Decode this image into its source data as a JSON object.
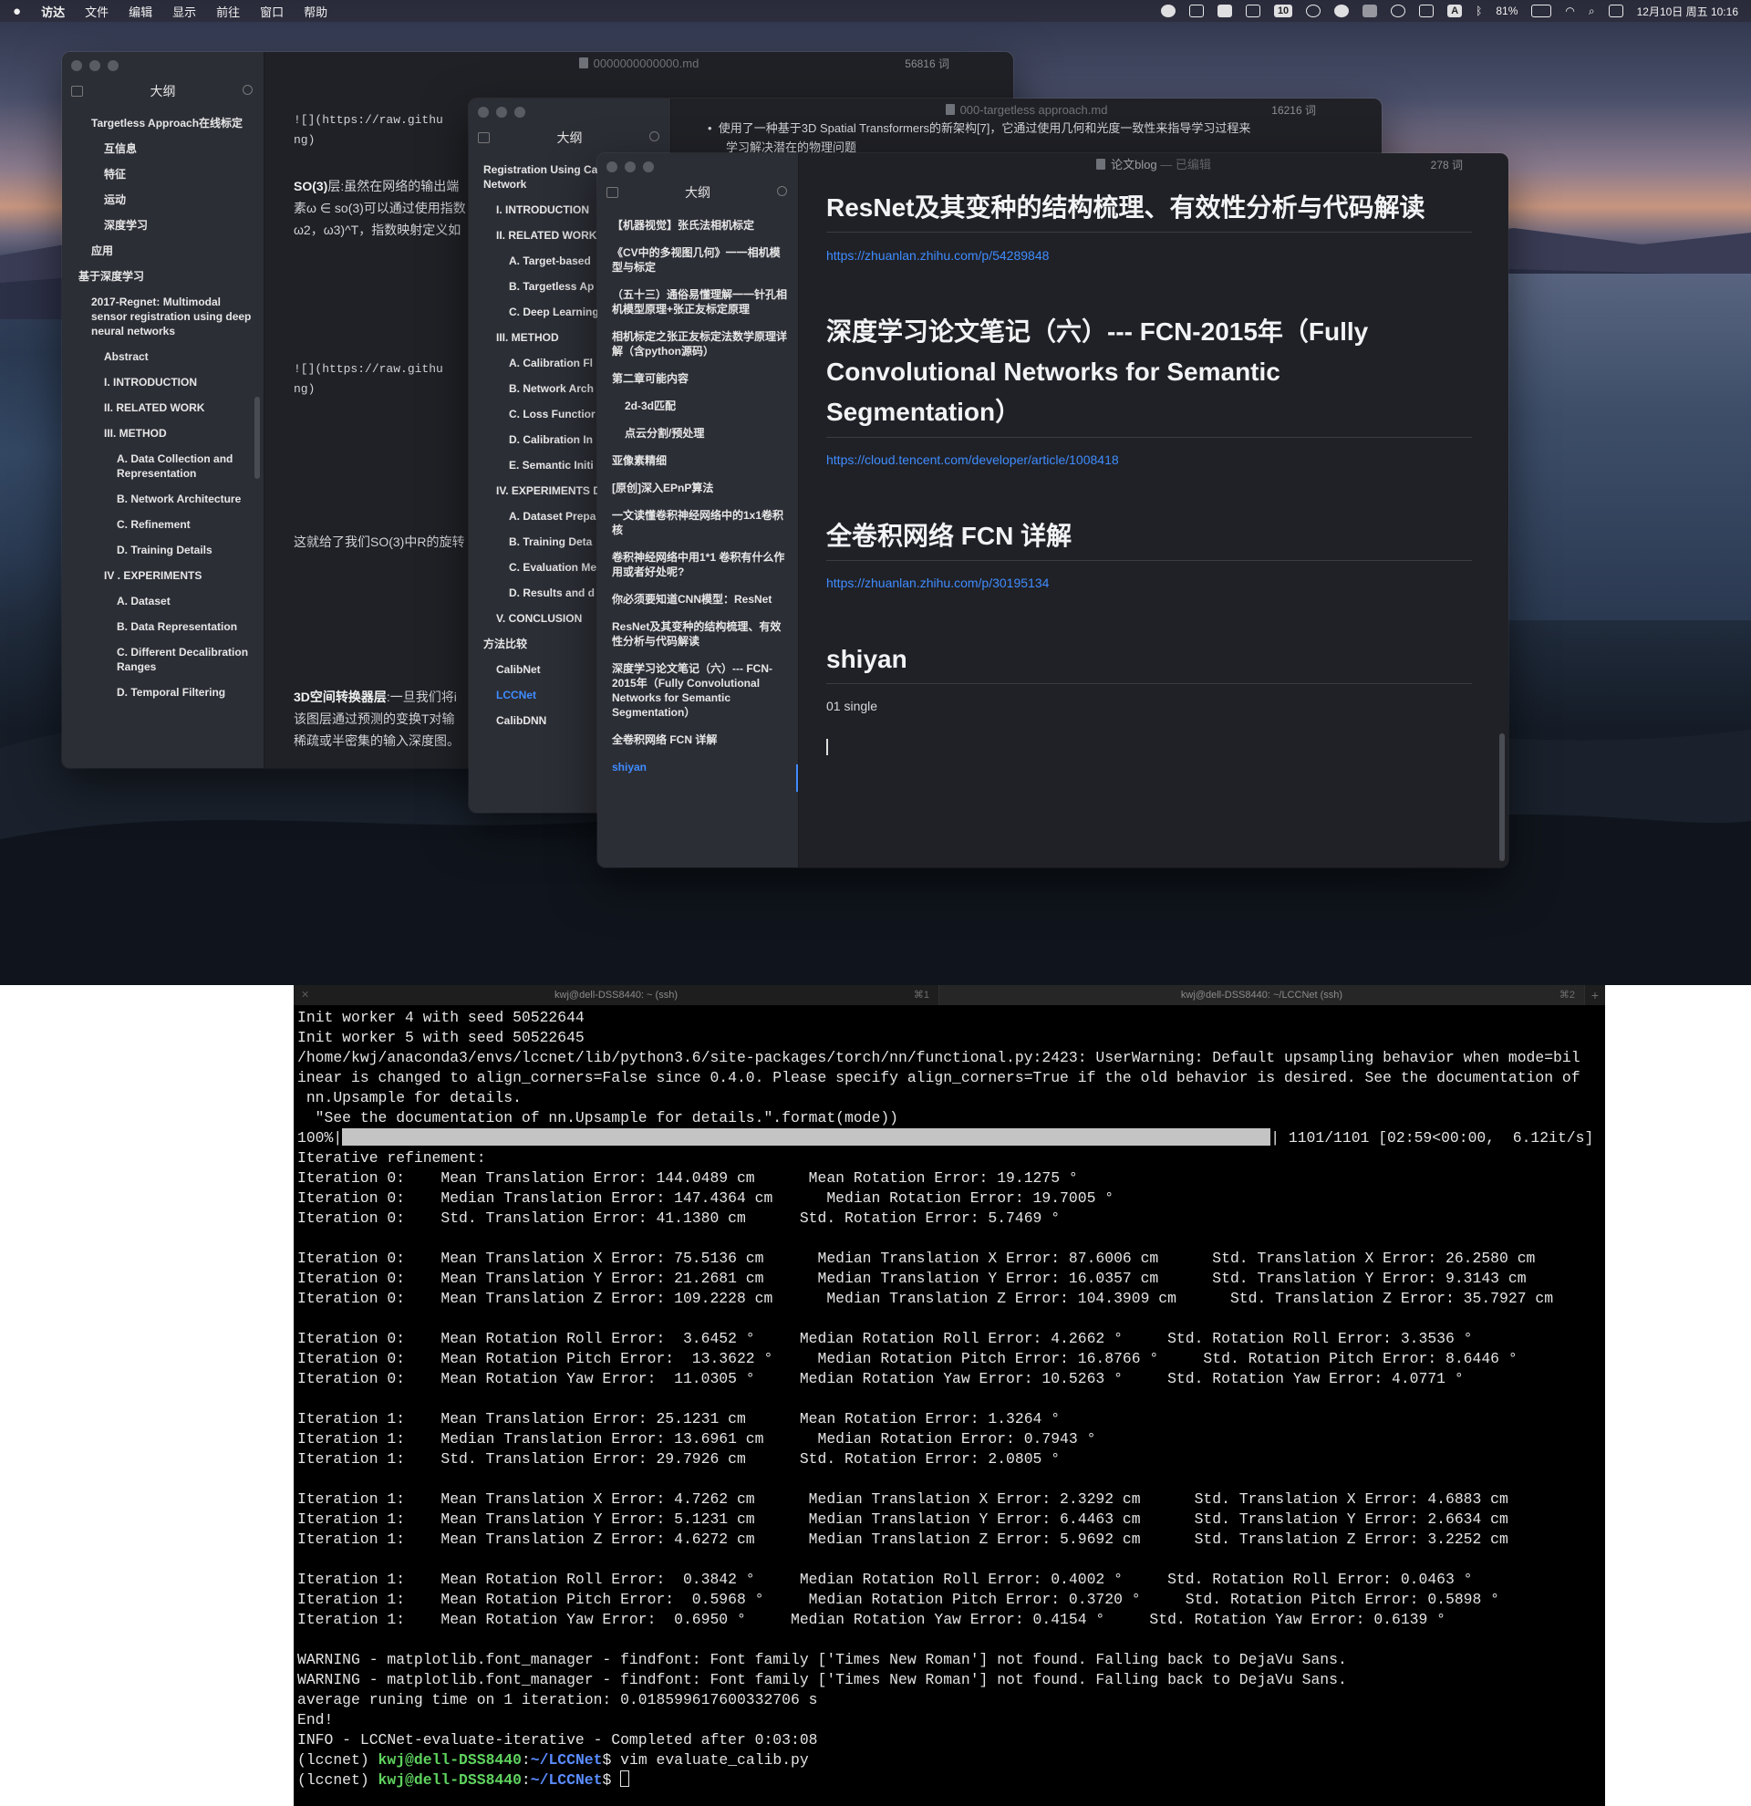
{
  "menubar": {
    "apple": "",
    "items": [
      "访达",
      "文件",
      "编辑",
      "显示",
      "前往",
      "窗口",
      "帮助"
    ],
    "status_icons": [
      "wechat-icon",
      "input-switch-icon",
      "app-icon",
      "app2-icon",
      "calendar-badge-icon",
      "sync-icon",
      "cloud-icon",
      "hat-icon",
      "record-icon",
      "volume-icon",
      "input-method-icon",
      "bluetooth-icon",
      "battery-icon",
      "wifi-icon",
      "search-icon",
      "control-center-icon"
    ],
    "calendar_badge": "10",
    "input_method": "A",
    "battery": "81%",
    "datetime": "12月10日 周五 10:16"
  },
  "window_back": {
    "title": "0000000000000.md",
    "wordcount": "56816 词",
    "sidebar_title": "大纲",
    "outline": [
      {
        "label": "Targetless Approach在线标定",
        "indent": 1
      },
      {
        "label": "互信息",
        "indent": 2
      },
      {
        "label": "特征",
        "indent": 2
      },
      {
        "label": "运动",
        "indent": 2
      },
      {
        "label": "深度学习",
        "indent": 2
      },
      {
        "label": "应用",
        "indent": 1
      },
      {
        "label": "基于深度学习",
        "indent": 0
      },
      {
        "label": "2017-Regnet: Multimodal sensor registration using deep neural networks",
        "indent": 1
      },
      {
        "label": "Abstract",
        "indent": 2
      },
      {
        "label": "I. INTRODUCTION",
        "indent": 2
      },
      {
        "label": "II. RELATED WORK",
        "indent": 2
      },
      {
        "label": "III. METHOD",
        "indent": 2
      },
      {
        "label": "A. Data Collection and Representation",
        "indent": 3
      },
      {
        "label": "B. Network Architecture",
        "indent": 3
      },
      {
        "label": "C. Refinement",
        "indent": 3
      },
      {
        "label": "D. Training Details",
        "indent": 3
      },
      {
        "label": "IV . EXPERIMENTS",
        "indent": 2
      },
      {
        "label": "A. Dataset",
        "indent": 3
      },
      {
        "label": "B. Data Representation",
        "indent": 3
      },
      {
        "label": "C. Different Decalibration Ranges",
        "indent": 3
      },
      {
        "label": "D. Temporal Filtering",
        "indent": 3
      }
    ],
    "editor": {
      "l1": "![](https://raw.githu",
      "l2": "ng)",
      "so3_bold": "SO(3)",
      "so3_rest": "层:虽然在网络的输出端",
      "l4": "素ω ∈ so(3)可以通过使用指数",
      "l5": "ω2，ω3)^T，指数映射定义如",
      "l6": "![](https://raw.githu",
      "l7": "ng)",
      "l8": "这就给了我们SO(3)中R的旋转",
      "st_bold": "3D空间转换器层",
      "st_rest": ":一旦我们将i",
      "l10": "该图层通过预测的变换T对输",
      "l11": "稀疏或半密集的输入深度图。"
    }
  },
  "window_mid": {
    "title": "000-targetless approach.md",
    "wordcount": "16216 词",
    "sidebar_title": "大纲",
    "outline": [
      {
        "label": "Registration Using Ca Flow Network",
        "indent": 0
      },
      {
        "label": "I. INTRODUCTION",
        "indent": 1
      },
      {
        "label": "II. RELATED WORK",
        "indent": 1
      },
      {
        "label": "A. Target-based",
        "indent": 2
      },
      {
        "label": "B. Targetless Ap",
        "indent": 2
      },
      {
        "label": "C. Deep Learning Approach",
        "indent": 2
      },
      {
        "label": "III. METHOD",
        "indent": 1
      },
      {
        "label": "A. Calibration Fl",
        "indent": 2
      },
      {
        "label": "B. Network Arch",
        "indent": 2
      },
      {
        "label": "C. Loss Functior",
        "indent": 2
      },
      {
        "label": "D. Calibration In",
        "indent": 2
      },
      {
        "label": "E. Semantic Initi",
        "indent": 2
      },
      {
        "label": "IV. EXPERIMENTS DISCUSSION",
        "indent": 1
      },
      {
        "label": "A. Dataset Prepa",
        "indent": 2
      },
      {
        "label": "B. Training Deta",
        "indent": 2
      },
      {
        "label": "C. Evaluation Me",
        "indent": 2
      },
      {
        "label": "D. Results and d",
        "indent": 2
      },
      {
        "label": "V. CONCLUSION",
        "indent": 1
      },
      {
        "label": "方法比较",
        "indent": 0
      },
      {
        "label": "CalibNet",
        "indent": 1
      },
      {
        "label": "LCCNet",
        "indent": 1,
        "active": true
      },
      {
        "label": "CalibDNN",
        "indent": 1
      }
    ],
    "editor": {
      "l1": "使用了一种基于3D Spatial Transformers的新架构[7]，它通过使用几何和光度一致性来指导学习过程来",
      "l2": "学习解决潜在的物理问题"
    }
  },
  "window_front": {
    "title": "论文blog",
    "title_suffix": "— 已编辑",
    "wordcount": "278 词",
    "sidebar_title": "大纲",
    "outline": [
      {
        "label": "【机器视觉】张氏法相机标定",
        "indent": 0
      },
      {
        "label": "《CV中的多视图几何》一一相机模型与标定",
        "indent": 0
      },
      {
        "label": "（五十三）通俗易懂理解一一针孔相机模型原理+张正友标定原理",
        "indent": 0
      },
      {
        "label": "相机标定之张正友标定法数学原理详解（含python源码）",
        "indent": 0
      },
      {
        "label": "第二章可能内容",
        "indent": 0
      },
      {
        "label": "2d-3d匹配",
        "indent": 1
      },
      {
        "label": "点云分割/预处理",
        "indent": 1
      },
      {
        "label": "亚像素精细",
        "indent": 0
      },
      {
        "label": "[原创]深入EPnP算法",
        "indent": 0
      },
      {
        "label": "一文读懂卷积神经网络中的1x1卷积核",
        "indent": 0
      },
      {
        "label": "卷积神经网络中用1*1 卷积有什么作用或者好处呢?",
        "indent": 0
      },
      {
        "label": "你必须要知道CNN模型：ResNet",
        "indent": 0
      },
      {
        "label": "ResNet及其变种的结构梳理、有效性分析与代码解读",
        "indent": 0
      },
      {
        "label": "深度学习论文笔记（六）--- FCN-2015年（Fully Convolutional Networks for Semantic Segmentation）",
        "indent": 0
      },
      {
        "label": "全卷积网络 FCN 详解",
        "indent": 0
      },
      {
        "label": "shiyan",
        "indent": 0,
        "active": true
      }
    ],
    "content": {
      "h1": "ResNet及其变种的结构梳理、有效性分析与代码解读",
      "link1": "https://zhuanlan.zhihu.com/p/54289848",
      "h2_line1": "深度学习论文笔记（六）--- FCN-2015年（Fully",
      "h2_line2": "Convolutional Networks for Semantic",
      "h2_line3": "Segmentation）",
      "link2": "https://cloud.tencent.com/developer/article/1008418",
      "h3": "全卷积网络 FCN 详解",
      "link3": "https://zhuanlan.zhihu.com/p/30195134",
      "h4": "shiyan",
      "para": "01 single"
    }
  },
  "terminal": {
    "tabs": [
      {
        "title": "kwj@dell-DSS8440: ~ (ssh)",
        "shortcut": "⌘1",
        "close": "✕"
      },
      {
        "title": "kwj@dell-DSS8440: ~/LCCNet (ssh)",
        "shortcut": "⌘2"
      }
    ],
    "new_tab": "+",
    "lines_before": [
      "Init worker 4 with seed 50522644",
      "Init worker 5 with seed 50522645",
      "/home/kwj/anaconda3/envs/lccnet/lib/python3.6/site-packages/torch/nn/functional.py:2423: UserWarning: Default upsampling behavior when mode=bil",
      "inear is changed to align_corners=False since 0.4.0. Please specify align_corners=True if the old behavior is desired. See the documentation of",
      " nn.Upsample for details.",
      "  \"See the documentation of nn.Upsample for details.\".format(mode))"
    ],
    "progress": {
      "prefix": "100%|",
      "percent": 1.0,
      "suffix": "| 1101/1101 [02:59<00:00,  6.12it/s]"
    },
    "lines_after": [
      "Iterative refinement:",
      "Iteration 0:    Mean Translation Error: 144.0489 cm      Mean Rotation Error: 19.1275 °",
      "Iteration 0:    Median Translation Error: 147.4364 cm      Median Rotation Error: 19.7005 °",
      "Iteration 0:    Std. Translation Error: 41.1380 cm      Std. Rotation Error: 5.7469 °",
      "",
      "Iteration 0:    Mean Translation X Error: 75.5136 cm      Median Translation X Error: 87.6006 cm      Std. Translation X Error: 26.2580 cm",
      "Iteration 0:    Mean Translation Y Error: 21.2681 cm      Median Translation Y Error: 16.0357 cm      Std. Translation Y Error: 9.3143 cm",
      "Iteration 0:    Mean Translation Z Error: 109.2228 cm      Median Translation Z Error: 104.3909 cm      Std. Translation Z Error: 35.7927 cm",
      "",
      "Iteration 0:    Mean Rotation Roll Error:  3.6452 °     Median Rotation Roll Error: 4.2662 °     Std. Rotation Roll Error: 3.3536 °",
      "Iteration 0:    Mean Rotation Pitch Error:  13.3622 °     Median Rotation Pitch Error: 16.8766 °     Std. Rotation Pitch Error: 8.6446 °",
      "Iteration 0:    Mean Rotation Yaw Error:  11.0305 °     Median Rotation Yaw Error: 10.5263 °     Std. Rotation Yaw Error: 4.0771 °",
      "",
      "Iteration 1:    Mean Translation Error: 25.1231 cm      Mean Rotation Error: 1.3264 °",
      "Iteration 1:    Median Translation Error: 13.6961 cm      Median Rotation Error: 0.7943 °",
      "Iteration 1:    Std. Translation Error: 29.7926 cm      Std. Rotation Error: 2.0805 °",
      "",
      "Iteration 1:    Mean Translation X Error: 4.7262 cm      Median Translation X Error: 2.3292 cm      Std. Translation X Error: 4.6883 cm",
      "Iteration 1:    Mean Translation Y Error: 5.1231 cm      Median Translation Y Error: 6.4463 cm      Std. Translation Y Error: 2.6634 cm",
      "Iteration 1:    Mean Translation Z Error: 4.6272 cm      Median Translation Z Error: 5.9692 cm      Std. Translation Z Error: 3.2252 cm",
      "",
      "Iteration 1:    Mean Rotation Roll Error:  0.3842 °     Median Rotation Roll Error: 0.4002 °     Std. Rotation Roll Error: 0.0463 °",
      "Iteration 1:    Mean Rotation Pitch Error:  0.5968 °     Median Rotation Pitch Error: 0.3720 °     Std. Rotation Pitch Error: 0.5898 °",
      "Iteration 1:    Mean Rotation Yaw Error:  0.6950 °     Median Rotation Yaw Error: 0.4154 °     Std. Rotation Yaw Error: 0.6139 °",
      "",
      "WARNING - matplotlib.font_manager - findfont: Font family ['Times New Roman'] not found. Falling back to DejaVu Sans.",
      "WARNING - matplotlib.font_manager - findfont: Font family ['Times New Roman'] not found. Falling back to DejaVu Sans.",
      "average runing time on 1 iteration: 0.018599617600332706 s",
      "End!",
      "INFO - LCCNet-evaluate-iterative - Completed after 0:03:08"
    ],
    "prompts": [
      {
        "env": "(lccnet) ",
        "user": "kwj@dell-DSS8440",
        "sep": ":",
        "path": "~/LCCNet",
        "sym": "$ ",
        "cmd": "vim evaluate_calib.py"
      },
      {
        "env": "(lccnet) ",
        "user": "kwj@dell-DSS8440",
        "sep": ":",
        "path": "~/LCCNet",
        "sym": "$ ",
        "cmd": ""
      }
    ]
  },
  "colors": {
    "accent_blue": "#3f8cff",
    "prompt_green": "#5fd35f",
    "prompt_blue": "#5a8cff"
  }
}
